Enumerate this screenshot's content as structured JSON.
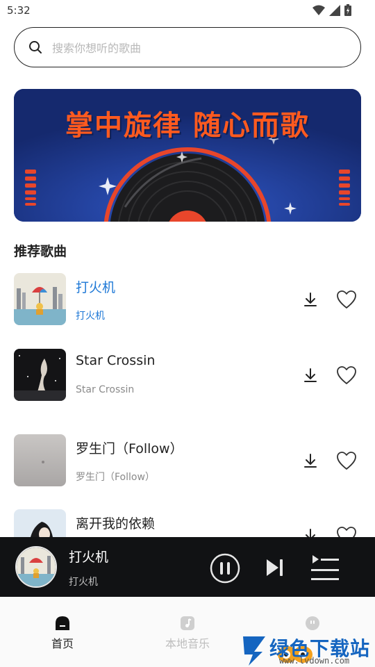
{
  "status_bar": {
    "time": "5:32"
  },
  "search": {
    "placeholder": "搜索你想听的歌曲"
  },
  "banner": {
    "title": "掌中旋律 随心而歌"
  },
  "section": {
    "title": "推荐歌曲"
  },
  "songs": [
    {
      "title": "打火机",
      "artist": "打火机",
      "active": true
    },
    {
      "title": "Star Crossin",
      "artist": "Star Crossin",
      "active": false
    },
    {
      "title": "罗生门（Follow）",
      "artist": "罗生门（Follow）",
      "active": false
    },
    {
      "title": "离开我的依赖",
      "artist": "",
      "active": false
    }
  ],
  "player": {
    "title": "打火机",
    "artist": "打火机"
  },
  "nav": [
    {
      "label": "首页",
      "icon": "home-icon",
      "active": true
    },
    {
      "label": "本地音乐",
      "icon": "local-music-icon",
      "active": false
    },
    {
      "label": "",
      "icon": "profile-icon",
      "active": false
    }
  ],
  "watermark": {
    "title": "绿色下载站",
    "url": "www.lvdown.com"
  },
  "colors": {
    "accent": "#1e78d6",
    "player_bg": "#111214",
    "banner_bg": "#1f3a8a",
    "banner_text": "#ff5a1f"
  }
}
